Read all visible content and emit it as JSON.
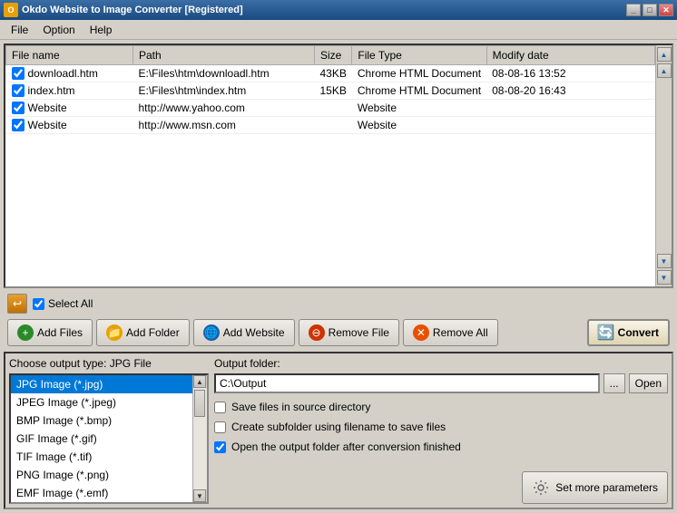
{
  "titlebar": {
    "title": "Okdo Website to Image Converter [Registered]",
    "icon": "O",
    "controls": [
      "_",
      "□",
      "✕"
    ]
  },
  "menubar": {
    "items": [
      "File",
      "Option",
      "Help"
    ]
  },
  "filelist": {
    "columns": [
      "File name",
      "Path",
      "Size",
      "File Type",
      "Modify date"
    ],
    "rows": [
      {
        "checked": true,
        "name": "downloadl.htm",
        "path": "E:\\Files\\htm\\downloadl.htm",
        "size": "43KB",
        "type": "Chrome HTML Document",
        "modified": "08-08-16 13:52"
      },
      {
        "checked": true,
        "name": "index.htm",
        "path": "E:\\Files\\htm\\index.htm",
        "size": "15KB",
        "type": "Chrome HTML Document",
        "modified": "08-08-20 16:43"
      },
      {
        "checked": true,
        "name": "Website",
        "path": "http://www.yahoo.com",
        "size": "",
        "type": "Website",
        "modified": ""
      },
      {
        "checked": true,
        "name": "Website",
        "path": "http://www.msn.com",
        "size": "",
        "type": "Website",
        "modified": ""
      }
    ]
  },
  "toolbar": {
    "select_all_label": "Select All",
    "add_files_label": "Add Files",
    "add_folder_label": "Add Folder",
    "add_website_label": "Add Website",
    "remove_file_label": "Remove File",
    "remove_all_label": "Remove All",
    "convert_label": "Convert"
  },
  "output_type": {
    "label": "Choose output type:",
    "selected": "JPG File",
    "options": [
      "JPG Image (*.jpg)",
      "JPEG Image (*.jpeg)",
      "BMP Image (*.bmp)",
      "GIF Image (*.gif)",
      "TIF Image (*.tif)",
      "PNG Image (*.png)",
      "EMF Image (*.emf)"
    ]
  },
  "output_folder": {
    "label": "Output folder:",
    "value": "C:\\Output",
    "browse_label": "...",
    "open_label": "Open"
  },
  "options": {
    "save_in_source": {
      "label": "Save files in source directory",
      "checked": false
    },
    "create_subfolder": {
      "label": "Create subfolder using filename to save files",
      "checked": false
    },
    "open_after": {
      "label": "Open the output folder after conversion finished",
      "checked": true
    }
  },
  "set_params_label": "Set more parameters",
  "scrollbar": {
    "top_arrows": [
      "▲",
      "▲"
    ],
    "bottom_arrows": [
      "▼",
      "▼"
    ]
  }
}
